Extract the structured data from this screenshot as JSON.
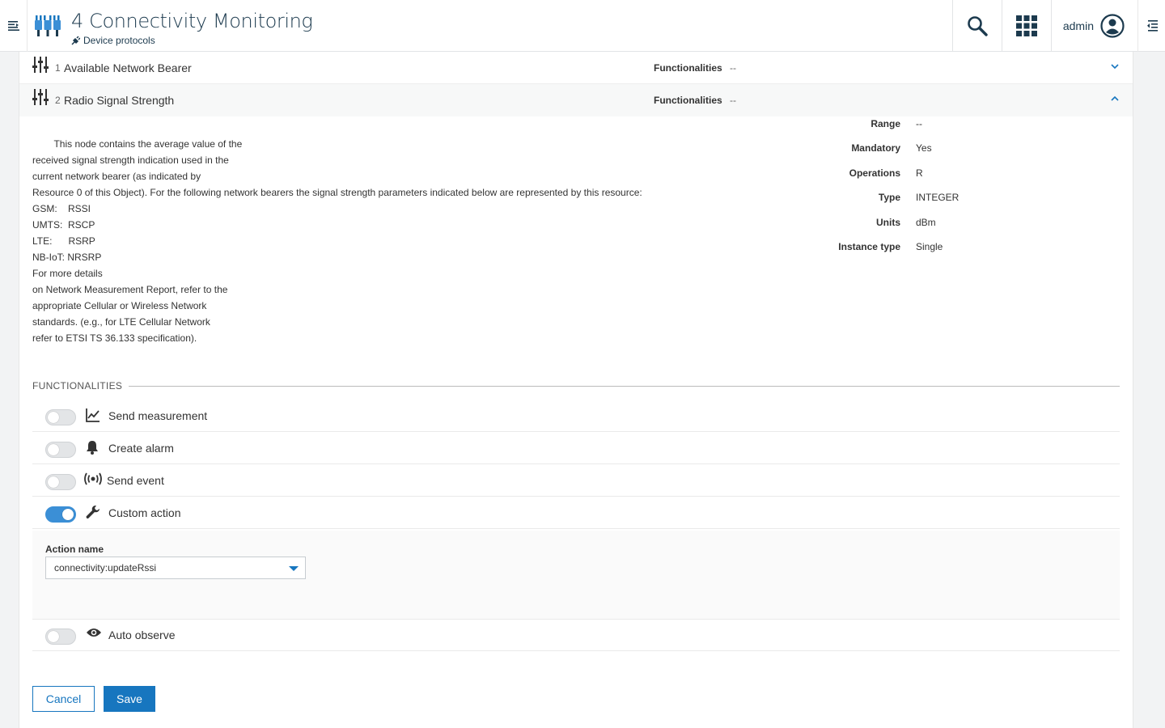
{
  "header": {
    "title": "4 Connectivity Monitoring",
    "breadcrumb": "Device protocols",
    "user": "admin"
  },
  "resources": [
    {
      "num": "1",
      "name": "Available Network Bearer",
      "func_label": "Functionalities",
      "func_value": "--"
    },
    {
      "num": "2",
      "name": "Radio Signal Strength",
      "func_label": "Functionalities",
      "func_value": "--"
    }
  ],
  "description": [
    "        This node contains the average value of the",
    "received signal strength indication used in the",
    "current network bearer (as indicated by",
    "Resource 0 of this Object). For the following network bearers the signal strength parameters indicated below are represented by this resource:",
    "GSM:    RSSI",
    "UMTS:  RSCP",
    "LTE:      RSRP",
    "NB-IoT: NRSRP",
    "For more details",
    "on Network Measurement Report, refer to the",
    "appropriate Cellular or Wireless Network",
    "standards. (e.g., for LTE Cellular Network",
    "refer to ETSI TS 36.133 specification)."
  ],
  "properties": [
    {
      "key": "Range",
      "value": "--"
    },
    {
      "key": "Mandatory",
      "value": "Yes"
    },
    {
      "key": "Operations",
      "value": "R"
    },
    {
      "key": "Type",
      "value": "INTEGER"
    },
    {
      "key": "Units",
      "value": "dBm"
    },
    {
      "key": "Instance type",
      "value": "Single"
    }
  ],
  "functionalities": {
    "heading": "FUNCTIONALITIES",
    "items": [
      {
        "label": "Send measurement",
        "enabled": false,
        "icon": "line-chart-icon"
      },
      {
        "label": "Create alarm",
        "enabled": false,
        "icon": "bell-icon"
      },
      {
        "label": "Send event",
        "enabled": false,
        "icon": "broadcast-icon"
      },
      {
        "label": "Custom action",
        "enabled": true,
        "icon": "wrench-icon"
      },
      {
        "label": "Auto observe",
        "enabled": false,
        "icon": "eye-icon"
      }
    ],
    "action_name_label": "Action name",
    "action_name_value": "connectivity:updateRssi"
  },
  "buttons": {
    "cancel": "Cancel",
    "save": "Save"
  },
  "colors": {
    "primary": "#1776bf",
    "title": "#1c3a4e",
    "toggle_on": "#3b8fd6"
  }
}
